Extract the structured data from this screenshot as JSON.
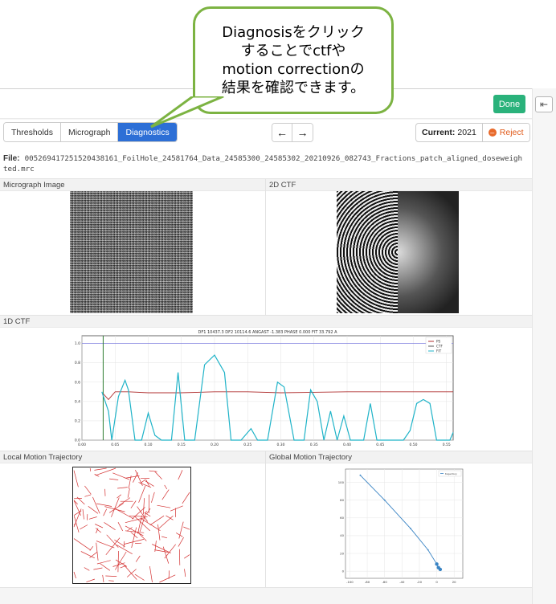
{
  "callout": {
    "lines": [
      "Diagnosisをクリック",
      "することでctfや",
      "motion correctionの",
      "結果を確認できます。"
    ],
    "border_color": "#7cb342"
  },
  "toolbar": {
    "done_label": "Done",
    "exit_icon": "exit-icon"
  },
  "tabs": [
    {
      "label": "Thresholds",
      "active": false
    },
    {
      "label": "Micrograph",
      "active": false
    },
    {
      "label": "Diagnostics",
      "active": true
    }
  ],
  "nav": {
    "prev": "←",
    "next": "→"
  },
  "current": {
    "label": "Current:",
    "value": "2021"
  },
  "reject": {
    "label": "Reject",
    "icon": "minus-circle-icon",
    "color": "#e05a1a"
  },
  "file": {
    "label": "File:",
    "name": "005269417251520438161_FoilHole_24581764_Data_24585300_24585302_20210926_082743_Fractions_patch_aligned_doseweighted.mrc"
  },
  "sections": {
    "micrograph_image": "Micrograph Image",
    "ctf_2d": "2D CTF",
    "ctf_1d": "1D CTF",
    "local_motion": "Local Motion Trajectory",
    "global_motion": "Global Motion Trajectory"
  },
  "colors": {
    "accent": "#2d6fd6",
    "done": "#2ab27b",
    "ps": "#b03030",
    "ctf": "#555555",
    "fit": "#1fb3c8"
  },
  "chart_data": [
    {
      "type": "line",
      "title": "DF1 10437.3 DF2 10114.6 ANGAST -1.383 PHASE 0.000 FIT 33.792 A",
      "x_ticks": [
        "0.00",
        "0.05",
        "0.10",
        "0.15",
        "0.20",
        "0.25",
        "0.30",
        "0.35",
        "0.40",
        "0.45",
        "0.50",
        "0.55"
      ],
      "y_ticks": [
        "0.0",
        "0.2",
        "0.4",
        "0.6",
        "0.8",
        "1.0"
      ],
      "xlim": [
        0,
        0.56
      ],
      "ylim": [
        0,
        1.08
      ],
      "legend": [
        "PS",
        "CTF",
        "FIT"
      ],
      "legend_position": "top-right",
      "vertical_marker_x": 0.032,
      "hline_y": 1.0,
      "series": [
        {
          "name": "PS",
          "x": [
            0.032,
            0.04,
            0.05,
            0.07,
            0.1,
            0.15,
            0.2,
            0.25,
            0.3,
            0.4,
            0.5,
            0.56
          ],
          "values": [
            0.48,
            0.42,
            0.5,
            0.5,
            0.49,
            0.49,
            0.5,
            0.5,
            0.49,
            0.5,
            0.5,
            0.5
          ]
        },
        {
          "name": "FIT",
          "x": [
            0.03,
            0.04,
            0.045,
            0.055,
            0.065,
            0.07,
            0.08,
            0.09,
            0.1,
            0.11,
            0.12,
            0.135,
            0.145,
            0.155,
            0.17,
            0.185,
            0.2,
            0.215,
            0.225,
            0.24,
            0.255,
            0.265,
            0.28,
            0.295,
            0.305,
            0.32,
            0.335,
            0.345,
            0.355,
            0.365,
            0.375,
            0.385,
            0.395,
            0.405,
            0.415,
            0.425,
            0.435,
            0.445,
            0.455,
            0.465,
            0.475,
            0.485,
            0.495,
            0.505,
            0.515,
            0.525,
            0.535,
            0.545,
            0.555,
            0.56
          ],
          "values": [
            0.5,
            0.3,
            0.0,
            0.45,
            0.62,
            0.52,
            0.0,
            0.0,
            0.28,
            0.05,
            0.0,
            0.0,
            0.7,
            0.0,
            0.0,
            0.78,
            0.88,
            0.7,
            0.0,
            0.0,
            0.12,
            0.0,
            0.0,
            0.6,
            0.55,
            0.0,
            0.0,
            0.52,
            0.4,
            0.0,
            0.3,
            0.0,
            0.25,
            0.0,
            0.0,
            0.0,
            0.38,
            0.0,
            0.0,
            0.0,
            0.0,
            0.0,
            0.1,
            0.38,
            0.42,
            0.38,
            0.0,
            0.0,
            0.0,
            0.08
          ]
        }
      ]
    },
    {
      "type": "scatter",
      "title": "",
      "legend": [
        "trajectory"
      ],
      "legend_position": "top-right",
      "x_ticks": [
        "-100",
        "-80",
        "-60",
        "-40",
        "-20",
        "0",
        "20"
      ],
      "y_ticks": [
        "0",
        "20",
        "40",
        "60",
        "80",
        "100"
      ],
      "xlim": [
        -105,
        30
      ],
      "ylim": [
        -8,
        115
      ],
      "series": [
        {
          "name": "trajectory",
          "x": [
            -88,
            -60,
            -30,
            -10,
            0,
            2,
            4
          ],
          "values": [
            108,
            80,
            48,
            24,
            8,
            4,
            2
          ]
        }
      ]
    }
  ]
}
